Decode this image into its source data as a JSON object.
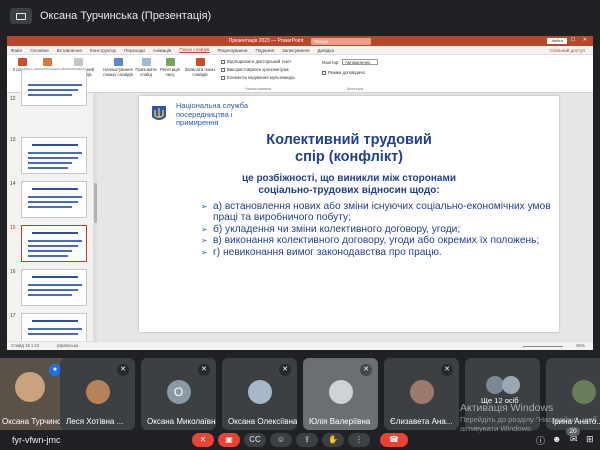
{
  "meet": {
    "presenter_title": "Оксана Турчинська (Презентація)",
    "meeting_code": "fyr-vfwn-jmc",
    "participants_count": "20",
    "more_people": "Ще 12 осіб",
    "windows_activation_title": "Активація Windows",
    "windows_activation_text": "Перейдіть до розділу \"Настройки\", щоб активувати Windows."
  },
  "ppt": {
    "file_title": "Презентація 2023 — PowerPoint",
    "search_placeholder": "Пошук",
    "sign_in": "Увійти",
    "tabs": [
      "Файл",
      "Основне",
      "Вставлення",
      "Конструктор",
      "Переходи",
      "Анімація",
      "Показ слайдів",
      "Рецензування",
      "Подання",
      "Записування",
      "Довідка"
    ],
    "active_tab": "Показ слайдів",
    "share": "Спільний доступ",
    "ribbon": {
      "from_start": "З початку",
      "from_current": "З поточного слайда",
      "custom_show": "Користувацький показ слайдів",
      "setup_show": "Налаштування показу слайдів",
      "hide_slide": "Приховати слайд",
      "rehearse": "Репетиція часу",
      "record": "Записати показ слайдів",
      "group_start": "Почати показ слайдів",
      "group_setup": "Налаштування",
      "group_monitors": "Монітори",
      "play_narrations": "Відтворювати дикторський текст",
      "use_timings": "Використовувати хронометраж",
      "show_media": "Елементи керування мультимедіа",
      "monitor_label": "Монітор:",
      "monitor_value": "Автоматично",
      "presenter_view": "Режим доповідача"
    },
    "status_left": "Слайд 15 з 24",
    "status_lang": "українська",
    "zoom": "81%",
    "thumb_numbers": [
      "12",
      "13",
      "14",
      "15",
      "16",
      "17"
    ]
  },
  "slide": {
    "org_line1": "Національна служба",
    "org_line2": "посередництва і",
    "org_line3": "примирення",
    "title_line1": "Колективний трудовий",
    "title_line2": "спір (конфлікт)",
    "def_line1": "це розбіжності, що виникли між сторонами",
    "def_line2": "соціально-трудових відносин щодо:",
    "bullets": [
      "а) встановлення нових або зміни існуючих соціально-економічних умов праці та виробничого побуту;",
      "б) укладення чи зміни колективного договору, угоди;",
      "в) виконання колективного договору, угоди або окремих їх положень;",
      "г) невиконання вимог законодавства про працю."
    ]
  },
  "tiles": [
    {
      "name": "Оксана Турчинська",
      "avatar_color": "#c9a27e"
    },
    {
      "name": "Леся Хотівна ...",
      "avatar_color": "#b5835a"
    },
    {
      "name": "Оксана Миколаївна",
      "avatar_letter": "О",
      "avatar_color": "#8d99a6"
    },
    {
      "name": "Оксана Олексіївна",
      "avatar_color": "#a7b8c8"
    },
    {
      "name": "Юлія Валеріївна",
      "avatar_color": "#cfd3d6"
    },
    {
      "name": "Єлизавета Ана...",
      "avatar_color": "#9b7b6b"
    },
    {
      "name": "Ще 12 осіб",
      "avatar_color": "#7a8794"
    },
    {
      "name": "Ірина Анато...",
      "avatar_color": "#6a7c5a"
    }
  ]
}
